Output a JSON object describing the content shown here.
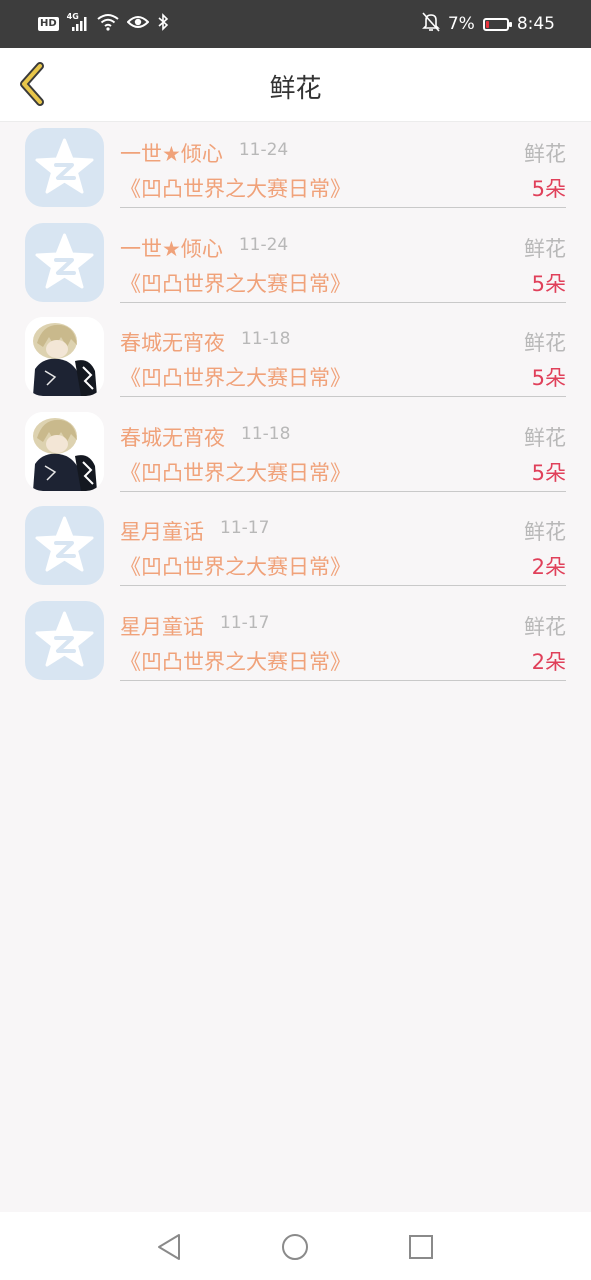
{
  "status_bar": {
    "hd": "HD",
    "network": "4G",
    "battery_percent_text": "7%",
    "battery_level": 0.07,
    "time": "8:45",
    "icons": [
      "hd-icon",
      "signal-icon",
      "wifi-icon",
      "eye-icon",
      "bluetooth-icon",
      "bell-off-icon",
      "battery-icon"
    ]
  },
  "header": {
    "title": "鲜花",
    "back_icon": "chevron-left-icon"
  },
  "colors": {
    "name_text": "#f0a27a",
    "count_text": "#e0405a",
    "muted_text": "#b8b8b8",
    "back_arrow": "#e8c64a"
  },
  "records": [
    {
      "name": "一世★倾心",
      "date": "11-24",
      "gift_type": "鲜花",
      "book": "《凹凸世界之大赛日常》",
      "count": "5朵",
      "avatar": "qq-default-avatar"
    },
    {
      "name": "一世★倾心",
      "date": "11-24",
      "gift_type": "鲜花",
      "book": "《凹凸世界之大赛日常》",
      "count": "5朵",
      "avatar": "qq-default-avatar"
    },
    {
      "name": "春城无宵夜",
      "date": "11-18",
      "gift_type": "鲜花",
      "book": "《凹凸世界之大赛日常》",
      "count": "5朵",
      "avatar": "anime-avatar"
    },
    {
      "name": "春城无宵夜",
      "date": "11-18",
      "gift_type": "鲜花",
      "book": "《凹凸世界之大赛日常》",
      "count": "5朵",
      "avatar": "anime-avatar"
    },
    {
      "name": "星月童话",
      "date": "11-17",
      "gift_type": "鲜花",
      "book": "《凹凸世界之大赛日常》",
      "count": "2朵",
      "avatar": "qq-default-avatar"
    },
    {
      "name": "星月童话",
      "date": "11-17",
      "gift_type": "鲜花",
      "book": "《凹凸世界之大赛日常》",
      "count": "2朵",
      "avatar": "qq-default-avatar"
    }
  ],
  "nav": {
    "icons": [
      "back-triangle-icon",
      "home-circle-icon",
      "recents-square-icon"
    ]
  }
}
